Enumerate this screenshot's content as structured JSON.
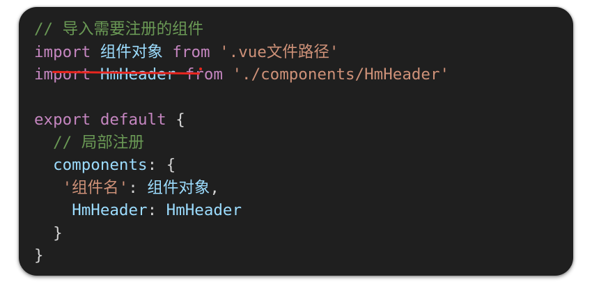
{
  "editor": {
    "lines": [
      {
        "comment": "// 导入需要注册的组件"
      },
      {
        "kw1": "import",
        "ident": "组件对象",
        "kw2": "from",
        "str": "'.vue文件路径'"
      },
      {
        "kw1": "import",
        "ident": "HmHeader",
        "kw2": "from",
        "str": "'./components/HmHeader'"
      },
      {},
      {
        "kw1": "export",
        "kw2": "default",
        "brace": "{"
      },
      {
        "comment": "// 局部注册"
      },
      {
        "ident": "components",
        "punct": ":",
        "brace": "{"
      },
      {
        "str": "'组件名'",
        "punct1": ":",
        "ident": "组件对象",
        "punct2": ","
      },
      {
        "ident1": "HmHeader",
        "punct": ":",
        "ident2": "HmHeader"
      },
      {
        "brace": "}"
      },
      {
        "brace": "}"
      }
    ]
  },
  "colors": {
    "background": "#1f1f1f",
    "comment": "#6a9955",
    "keyword": "#c586c0",
    "identifier": "#9cdcfe",
    "string": "#ce9178",
    "annotation": "#e8261f"
  }
}
